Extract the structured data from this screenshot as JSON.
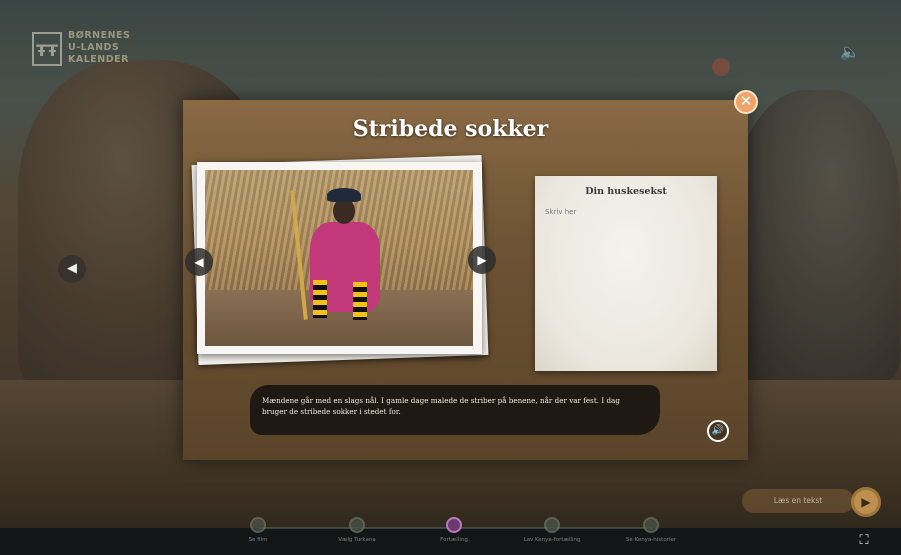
{
  "logo": {
    "mark": "ŦŦ",
    "line1": "BØRNENES",
    "line2": "U-LANDS",
    "line3": "KALENDER"
  },
  "top_right_text": "",
  "modal": {
    "title": "Stribede sokker",
    "close_label": "✕",
    "prev_label": "◀",
    "next_label": "▶"
  },
  "note": {
    "title": "Din huskesekst",
    "placeholder": "Skriv her"
  },
  "caption": {
    "text": "Mændene går med en slags nål. I gamle dage malede de striber på benene, når der var fest. I dag bruger de stribede sokker i stedet for."
  },
  "read_button": {
    "label": "Læs en tekst",
    "icon": "▶"
  },
  "steps": [
    {
      "label": "Se film"
    },
    {
      "label": "Vælg Turkana"
    },
    {
      "label": "Fortælling"
    },
    {
      "label": "Lav Kenya-fortælling"
    },
    {
      "label": "Se Kenya-historier"
    }
  ],
  "active_step": 2,
  "icons": {
    "speaker": "speaker-icon",
    "audio": "audio-icon",
    "fullscreen": "fullscreen-icon"
  }
}
